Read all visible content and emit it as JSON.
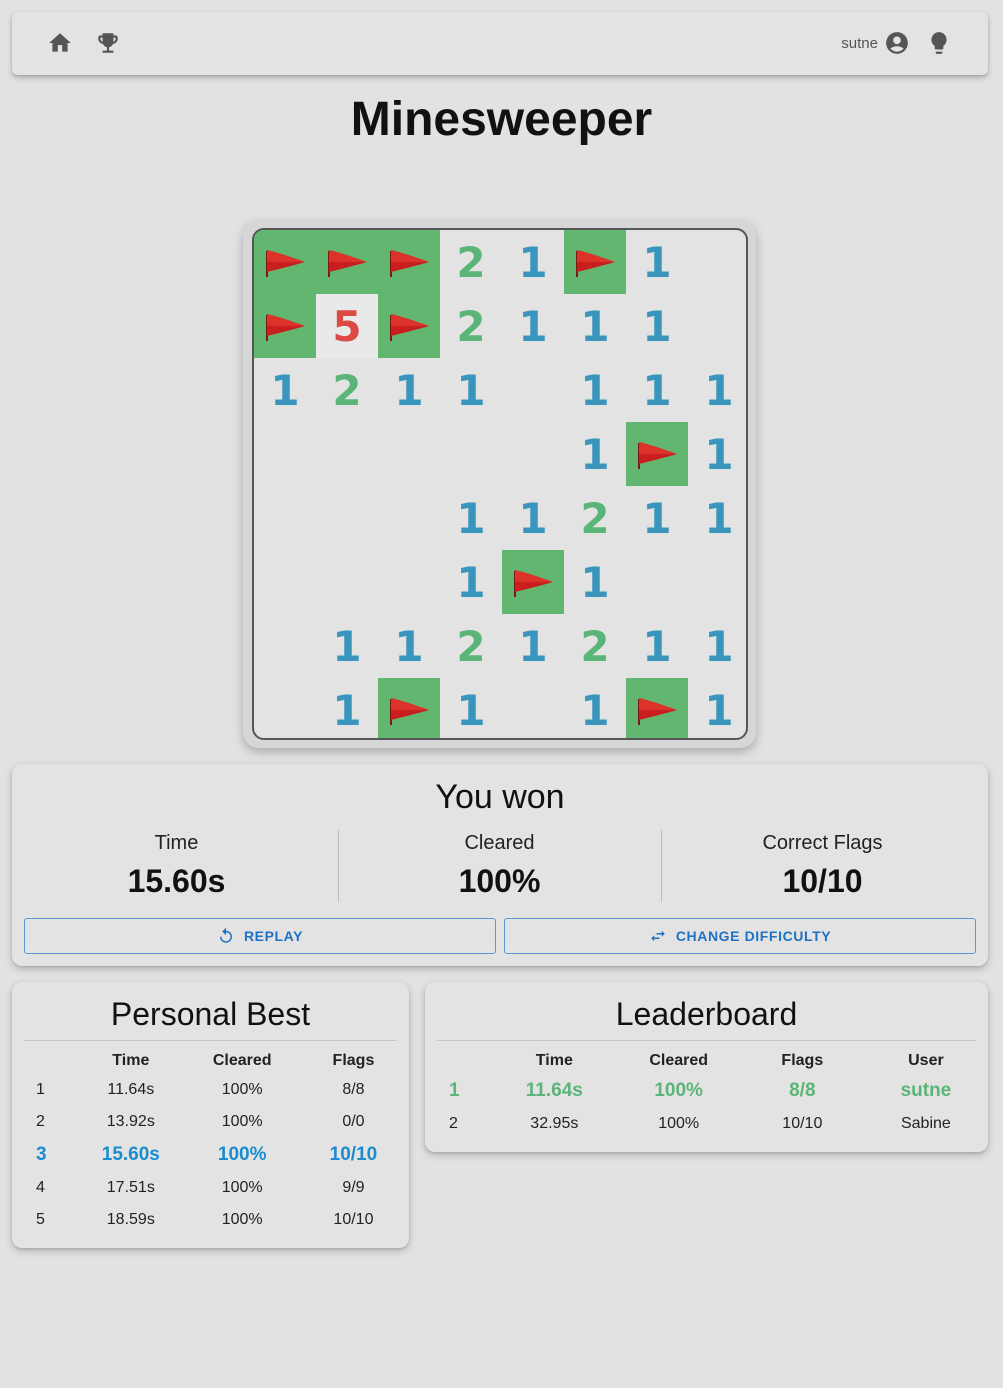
{
  "nav": {
    "username": "sutne",
    "icons": [
      "home-icon",
      "trophy-icon",
      "account-icon",
      "lightbulb-icon"
    ]
  },
  "page_title": "Minesweeper",
  "colors": {
    "flag_cell": "#63b66f",
    "num1": "#3a95bd",
    "num2": "#5cb578",
    "num5": "#dd4a45",
    "accent_blue": "#1e72c4",
    "winner_green": "#5cb578"
  },
  "board": {
    "rows": 8,
    "cols": 8,
    "legend": "F = flag, number = adjacent count, empty string = revealed blank",
    "cells": [
      [
        "F",
        "F",
        "F",
        "2",
        "1",
        "F",
        "1",
        ""
      ],
      [
        "F",
        "5",
        "F",
        "2",
        "1",
        "1",
        "1",
        ""
      ],
      [
        "1",
        "2",
        "1",
        "1",
        "",
        "1",
        "1",
        "1"
      ],
      [
        "",
        "",
        "",
        "",
        "",
        "1",
        "F",
        "1"
      ],
      [
        "",
        "",
        "",
        "1",
        "1",
        "2",
        "1",
        "1"
      ],
      [
        "",
        "",
        "",
        "1",
        "F",
        "1",
        "",
        ""
      ],
      [
        "",
        "1",
        "1",
        "2",
        "1",
        "2",
        "1",
        "1"
      ],
      [
        "",
        "1",
        "F",
        "1",
        "",
        "1",
        "F",
        "1"
      ]
    ]
  },
  "result": {
    "title": "You won",
    "stats": [
      {
        "label": "Time",
        "value": "15.60s"
      },
      {
        "label": "Cleared",
        "value": "100%"
      },
      {
        "label": "Correct Flags",
        "value": "10/10"
      }
    ],
    "replay_label": "REPLAY",
    "change_label": "CHANGE DIFFICULTY"
  },
  "personal_best": {
    "title": "Personal Best",
    "headers": [
      "",
      "Time",
      "Cleared",
      "Flags"
    ],
    "rows": [
      [
        "1",
        "11.64s",
        "100%",
        "8/8"
      ],
      [
        "2",
        "13.92s",
        "100%",
        "0/0"
      ],
      [
        "3",
        "15.60s",
        "100%",
        "10/10"
      ],
      [
        "4",
        "17.51s",
        "100%",
        "9/9"
      ],
      [
        "5",
        "18.59s",
        "100%",
        "10/10"
      ]
    ],
    "highlight_row": 2
  },
  "leaderboard": {
    "title": "Leaderboard",
    "headers": [
      "",
      "Time",
      "Cleared",
      "Flags",
      "User"
    ],
    "rows": [
      [
        "1",
        "11.64s",
        "100%",
        "8/8",
        "sutne"
      ],
      [
        "2",
        "32.95s",
        "100%",
        "10/10",
        "Sabine"
      ]
    ],
    "highlight_row": 0
  }
}
